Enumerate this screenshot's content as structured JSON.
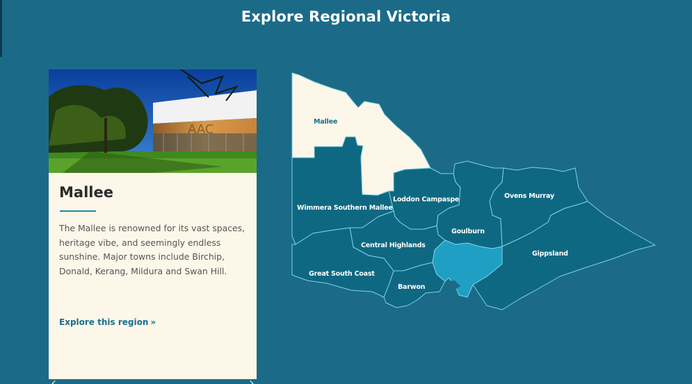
{
  "header": {
    "title": "Explore Regional Victoria"
  },
  "card": {
    "region_name": "Mallee",
    "description": "The Mallee is renowned for its vast spaces, heritage vibe, and seemingly endless sunshine. Major towns include Birchip, Donald, Kerang, Mildura and Swan Hill.",
    "link_label": "Explore this region",
    "link_icon": "double-chevron-right-icon",
    "image_alt": "photo-of-mallee-art-centre"
  },
  "map": {
    "regions": [
      {
        "id": "mallee",
        "label": "Mallee",
        "state": "selected"
      },
      {
        "id": "wimmera-southern-mallee",
        "label": "Wimmera Southern Mallee",
        "state": "default"
      },
      {
        "id": "loddon-campaspe",
        "label": "Loddon Campaspe",
        "state": "default"
      },
      {
        "id": "ovens-murray",
        "label": "Ovens Murray",
        "state": "default"
      },
      {
        "id": "goulburn",
        "label": "Goulburn",
        "state": "default"
      },
      {
        "id": "central-highlands",
        "label": "Central Highlands",
        "state": "default"
      },
      {
        "id": "gippsland",
        "label": "Gippsland",
        "state": "default"
      },
      {
        "id": "great-south-coast",
        "label": "Great South Coast",
        "state": "default"
      },
      {
        "id": "barwon",
        "label": "Barwon",
        "state": "default"
      },
      {
        "id": "melbourne",
        "label": "",
        "state": "highlight"
      }
    ]
  },
  "colors": {
    "background": "#1b6b88",
    "region_fill": "#0f6882",
    "region_border": "#7fd2e6",
    "selected_fill": "#fcf7e9",
    "selected_label": "#1a6f8e",
    "metro_fill": "#1f9fc4",
    "label_text": "#ffffff",
    "link_text": "#1a6f8e"
  }
}
